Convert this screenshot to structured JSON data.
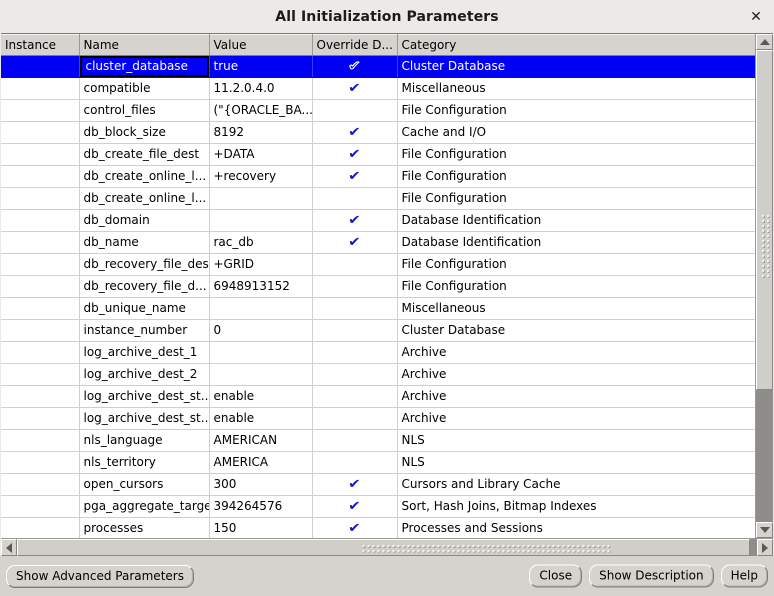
{
  "window": {
    "title": "All Initialization Parameters",
    "close_icon": "close-icon",
    "close_glyph": "✕"
  },
  "table": {
    "columns": [
      "Instance",
      "Name",
      "Value",
      "Override D...",
      "Category"
    ],
    "check_glyph": "✔",
    "selected_row_index": 0,
    "rows": [
      {
        "instance": "",
        "name": "cluster_database",
        "value": "true",
        "override": true,
        "category": "Cluster Database"
      },
      {
        "instance": "",
        "name": "compatible",
        "value": "11.2.0.4.0",
        "override": true,
        "category": "Miscellaneous"
      },
      {
        "instance": "",
        "name": "control_files",
        "value": "(\"{ORACLE_BA...",
        "override": false,
        "category": "File Configuration"
      },
      {
        "instance": "",
        "name": "db_block_size",
        "value": "8192",
        "override": true,
        "category": "Cache and I/O"
      },
      {
        "instance": "",
        "name": "db_create_file_dest",
        "value": "+DATA",
        "override": true,
        "category": "File Configuration"
      },
      {
        "instance": "",
        "name": "db_create_online_l...",
        "value": "+recovery",
        "override": true,
        "category": "File Configuration"
      },
      {
        "instance": "",
        "name": "db_create_online_l...",
        "value": "",
        "override": false,
        "category": "File Configuration"
      },
      {
        "instance": "",
        "name": "db_domain",
        "value": "",
        "override": true,
        "category": "Database Identification"
      },
      {
        "instance": "",
        "name": "db_name",
        "value": "rac_db",
        "override": true,
        "category": "Database Identification"
      },
      {
        "instance": "",
        "name": "db_recovery_file_dest",
        "value": "+GRID",
        "override": false,
        "category": "File Configuration"
      },
      {
        "instance": "",
        "name": "db_recovery_file_d...",
        "value": "6948913152",
        "override": false,
        "category": "File Configuration"
      },
      {
        "instance": "",
        "name": "db_unique_name",
        "value": "",
        "override": false,
        "category": "Miscellaneous"
      },
      {
        "instance": "",
        "name": "instance_number",
        "value": "0",
        "override": false,
        "category": "Cluster Database"
      },
      {
        "instance": "",
        "name": "log_archive_dest_1",
        "value": "",
        "override": false,
        "category": "Archive"
      },
      {
        "instance": "",
        "name": "log_archive_dest_2",
        "value": "",
        "override": false,
        "category": "Archive"
      },
      {
        "instance": "",
        "name": "log_archive_dest_st...",
        "value": "enable",
        "override": false,
        "category": "Archive"
      },
      {
        "instance": "",
        "name": "log_archive_dest_st...",
        "value": "enable",
        "override": false,
        "category": "Archive"
      },
      {
        "instance": "",
        "name": "nls_language",
        "value": "AMERICAN",
        "override": false,
        "category": "NLS"
      },
      {
        "instance": "",
        "name": "nls_territory",
        "value": "AMERICA",
        "override": false,
        "category": "NLS"
      },
      {
        "instance": "",
        "name": "open_cursors",
        "value": "300",
        "override": true,
        "category": "Cursors and Library Cache"
      },
      {
        "instance": "",
        "name": "pga_aggregate_target",
        "value": "394264576",
        "override": true,
        "category": "Sort, Hash Joins, Bitmap Indexes"
      },
      {
        "instance": "",
        "name": "processes",
        "value": "150",
        "override": true,
        "category": "Processes and Sessions"
      }
    ]
  },
  "scrollbars": {
    "vertical": {
      "up_icon": "arrow-up-icon",
      "down_icon": "arrow-down-icon"
    },
    "horizontal": {
      "left_icon": "arrow-left-icon",
      "right_icon": "arrow-right-icon"
    }
  },
  "buttons": {
    "show_advanced": "Show Advanced Parameters",
    "close": "Close",
    "show_description": "Show Description",
    "help": "Help"
  },
  "colors": {
    "selection": "#0000f5",
    "check": "#1414c8",
    "chrome": "#d6d3ce",
    "titlebar": "#eceae6"
  }
}
